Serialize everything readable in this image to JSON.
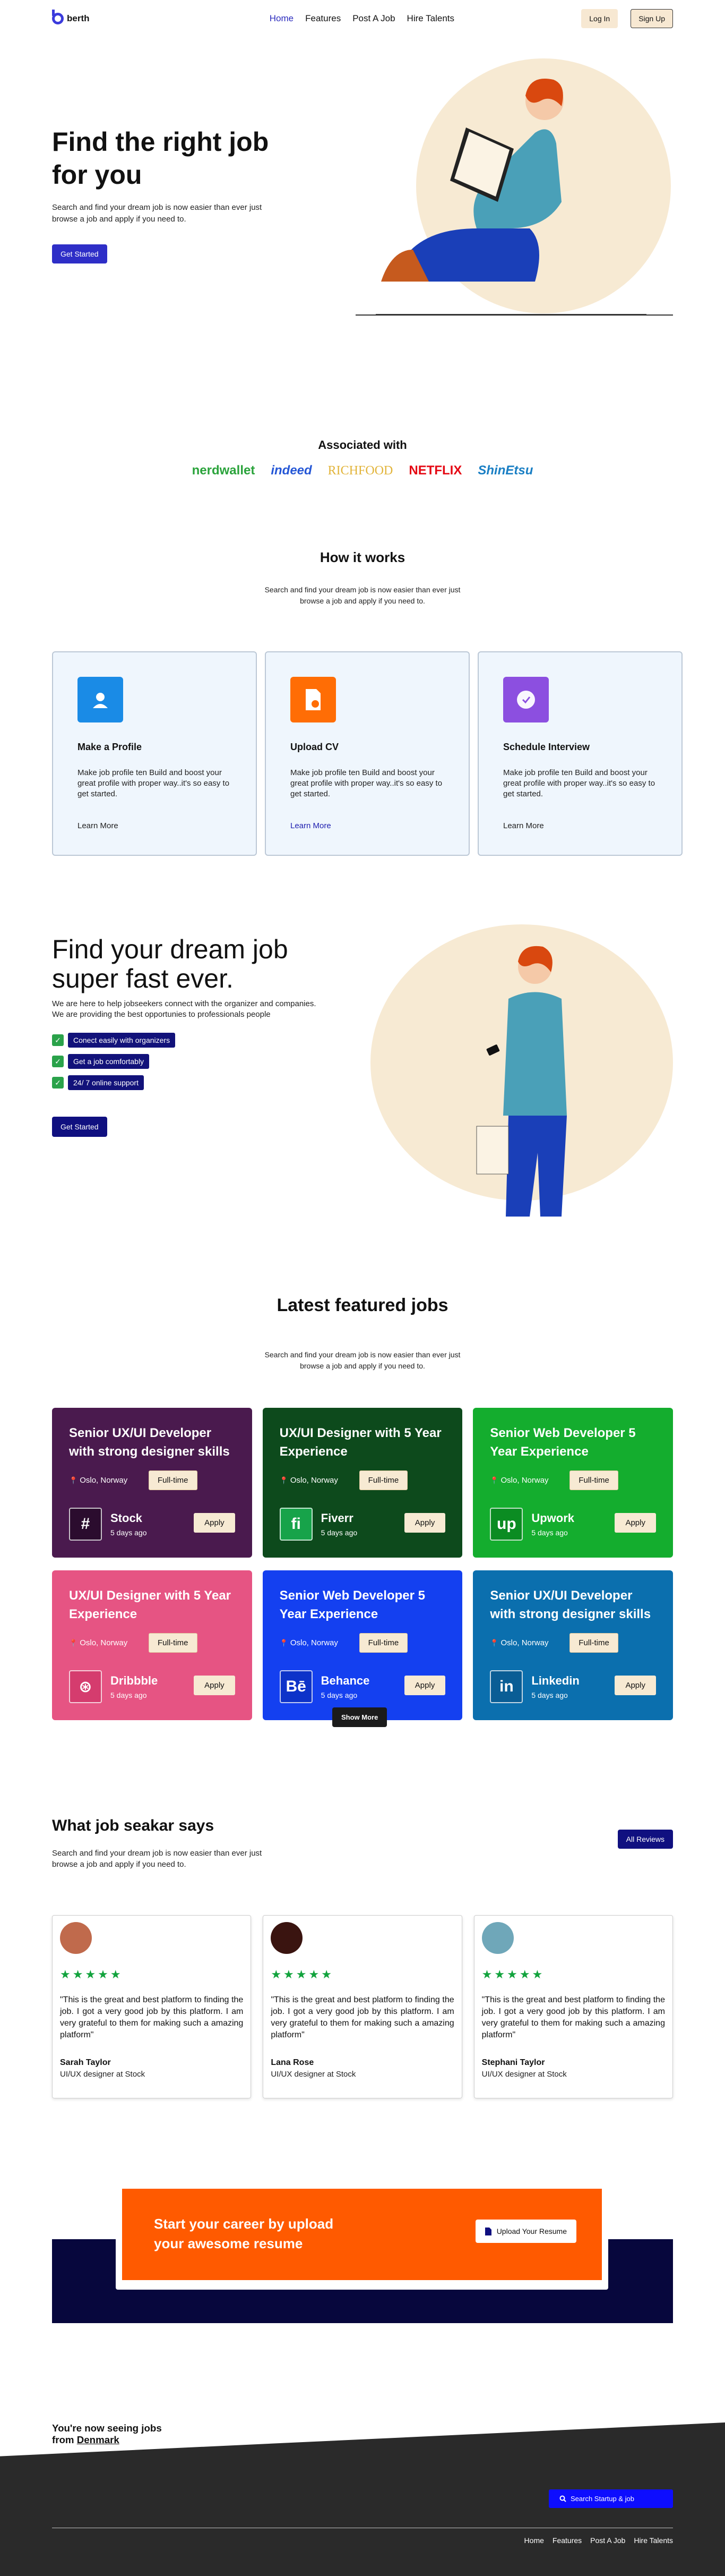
{
  "nav": {
    "brand": "berth",
    "links": [
      "Home",
      "Features",
      "Post A Job",
      "Hire Talents"
    ],
    "login": "Log In",
    "signup": "Sign Up"
  },
  "hero": {
    "title": "Find the right job for you",
    "text": "Search and find your dream job is now easier than ever just browse a job and apply if you need to.",
    "cta": "Get Started"
  },
  "associated": {
    "title": "Associated with",
    "logos": [
      "nerdwallet",
      "indeed",
      "RICHFOOD",
      "NETFLIX",
      "ShinEtsu"
    ]
  },
  "how": {
    "title": "How it works",
    "text": "Search and find your dream job is now easier than ever just browse a job and apply if you need to.",
    "cards": [
      {
        "title": "Make a Profile",
        "text": "Make job profile ten Build and boost your great profile with proper way..it's so easy to get started.",
        "link": "Learn More",
        "color": "#1a8be6",
        "icon": "user-icon"
      },
      {
        "title": "Upload CV",
        "text": "Make job profile ten Build and boost your great profile with proper way..it's so easy to get started.",
        "link": "Learn More",
        "color": "#ff6d05",
        "icon": "document-icon"
      },
      {
        "title": "Schedule Interview",
        "text": "Make job profile ten Build and boost your great profile with proper way..it's so easy to get started.",
        "link": "Learn More",
        "color": "#8c4fe0",
        "icon": "clock-icon"
      }
    ]
  },
  "dream": {
    "title": "Find your dream job super fast ever.",
    "text": "We are here to help jobseekers connect with the organizer and companies. We are providing the best opportunies to professionals people",
    "checks": [
      "Conect easily with organizers",
      "Get a job comfortably",
      "24/ 7 online support"
    ],
    "cta": "Get Started"
  },
  "jobs": {
    "title": "Latest featured jobs",
    "text": "Search and find your dream job is now easier than ever just browse a job and apply if you need to.",
    "items": [
      {
        "title": "Senior UX/UI Developer with strong designer skills",
        "location": "Oslo, Norway",
        "type": "Full-time",
        "company": "Stock",
        "ago": "5 days ago",
        "apply": "Apply",
        "bg": "#4a1a4e",
        "logo_bg": "#2b0c2e",
        "logo": "#"
      },
      {
        "title": "UX/UI Designer with 5 Year Experience",
        "location": "Oslo, Norway",
        "type": "Full-time",
        "company": "Fiverr",
        "ago": "5 days ago",
        "apply": "Apply",
        "bg": "#0d4a1c",
        "logo_bg": "#17a34a",
        "logo": "fi"
      },
      {
        "title": "Senior Web Developer 5 Year Experience",
        "location": "Oslo, Norway",
        "type": "Full-time",
        "company": "Upwork",
        "ago": "5 days ago",
        "apply": "Apply",
        "bg": "#14ad2e",
        "logo_bg": "#0b8c22",
        "logo": "up"
      },
      {
        "title": "UX/UI Designer with 5 Year Experience",
        "location": "Oslo, Norway",
        "type": "Full-time",
        "company": "Dribbble",
        "ago": "5 days ago",
        "apply": "Apply",
        "bg": "#e65483",
        "logo_bg": "#d53c6e",
        "logo": "⊛"
      },
      {
        "title": "Senior Web Developer 5 Year Experience",
        "location": "Oslo, Norway",
        "type": "Full-time",
        "company": "Behance",
        "ago": "5 days ago",
        "apply": "Apply",
        "bg": "#1440f0",
        "logo_bg": "#0d33c9",
        "logo": "Bē"
      },
      {
        "title": "Senior UX/UI Developer with strong designer skills",
        "location": "Oslo, Norway",
        "type": "Full-time",
        "company": "Linkedin",
        "ago": "5 days ago",
        "apply": "Apply",
        "bg": "#0b6fae",
        "logo_bg": "#0a5d95",
        "logo": "in"
      }
    ],
    "show_more": "Show More"
  },
  "reviews": {
    "title": "What job seakar says",
    "text": "Search and find your dream job is now easier than ever just browse a job and apply if you need to.",
    "all": "All Reviews",
    "items": [
      {
        "stars": "★★★★★",
        "quote": "\"This is the great and best platform to finding the job. I got a very good job by this platform. I am very grateful to them for making such a amazing platform\"",
        "name": "Sarah Taylor",
        "role": "UI/UX designer at Stock",
        "avatar": "#c06a4c"
      },
      {
        "stars": "★★★★★",
        "quote": "\"This is the great and best platform to finding the job. I got a very good job by this platform. I am very grateful to them for making such a amazing platform\"",
        "name": "Lana Rose",
        "role": "UI/UX designer at Stock",
        "avatar": "#3a1410"
      },
      {
        "stars": "★★★★★",
        "quote": "\"This is the great and best platform to finding the job. I got a very good job by this platform. I am very grateful to them for making such a amazing platform\"",
        "name": "Stephani Taylor",
        "role": "UI/UX designer at Stock",
        "avatar": "#6fa7b9"
      }
    ]
  },
  "cta": {
    "title": "Start your career by upload your awesome resume",
    "button": "Upload Your Resume"
  },
  "footer": {
    "line1": "You're now seeing jobs",
    "line2_prefix": "from ",
    "country": "Denmark",
    "search": "Search Startup & job",
    "links": [
      "Home",
      "Features",
      "Post A Job",
      "Hire Talents"
    ]
  }
}
